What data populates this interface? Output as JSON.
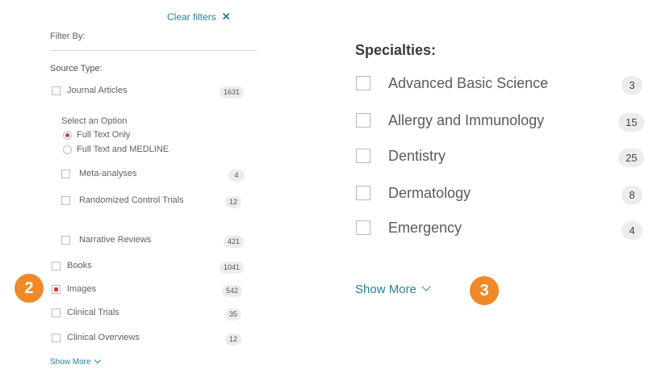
{
  "clear_filters": {
    "label": "Clear filters",
    "icon": "close-icon"
  },
  "filter_by": "Filter By:",
  "source_type": {
    "heading": "Source Type:",
    "journal_articles": {
      "label": "Journal Articles",
      "count": "1631",
      "checked": false
    },
    "select_option_label": "Select an Option",
    "options": [
      {
        "label": "Full Text Only",
        "selected": true
      },
      {
        "label": "Full Text and MEDLINE",
        "selected": false
      }
    ],
    "sub_items": [
      {
        "label": "Meta-analyses",
        "count": "4"
      },
      {
        "label": "Randomized Control Trials",
        "count": "12"
      },
      {
        "label": "Narrative Reviews",
        "count": "421"
      }
    ],
    "items": [
      {
        "label": "Books",
        "count": "1041",
        "checked": false
      },
      {
        "label": "Images",
        "count": "542",
        "checked": true
      },
      {
        "label": "Clinical Trials",
        "count": "35",
        "checked": false
      },
      {
        "label": "Clinical Overviews",
        "count": "12",
        "checked": false
      }
    ],
    "show_more": "Show More"
  },
  "specialties": {
    "title": "Specialties:",
    "items": [
      {
        "label": "Advanced Basic Science",
        "count": "3"
      },
      {
        "label": "Allergy and Immunology",
        "count": "15"
      },
      {
        "label": "Dentistry",
        "count": "25"
      },
      {
        "label": "Dermatology",
        "count": "8"
      },
      {
        "label": "Emergency",
        "count": "4"
      }
    ],
    "show_more": "Show More"
  },
  "badges": [
    "2",
    "3"
  ],
  "colors": {
    "accent": "#2a7f9c",
    "badge": "#f0892a",
    "check": "#d63a3a"
  }
}
